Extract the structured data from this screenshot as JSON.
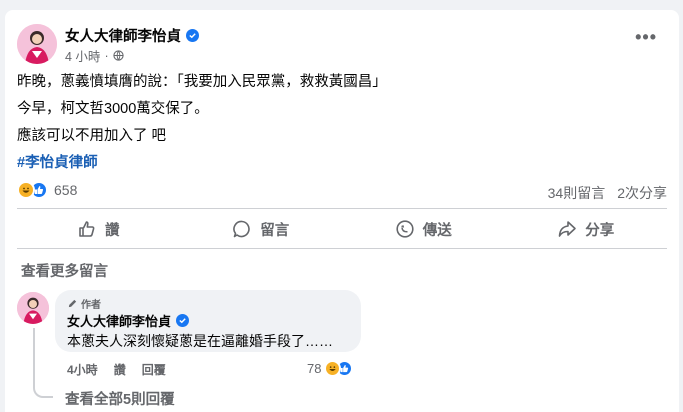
{
  "post": {
    "author": "女人大律師李怡貞",
    "time": "4 小時",
    "more_label": "•••",
    "lines": [
      "昨晚，蔥義憤填膺的說：「我要加入民眾黨，救救黃國昌」",
      "今早，柯文哲3000萬交保了。",
      "應該可以不用加入了 吧"
    ],
    "hashtag": "#李怡貞律師",
    "reaction_count": "658",
    "comment_count": "34則留言",
    "share_count": "2次分享"
  },
  "actions": {
    "like": "讚",
    "comment": "留言",
    "send": "傳送",
    "share": "分享"
  },
  "comments": {
    "view_more": "查看更多留言",
    "author_tag": "作者",
    "author": "女人大律師李怡貞",
    "text": "本蔥夫人深刻懷疑蔥是在逼離婚手段了……",
    "time": "4小時",
    "like": "讚",
    "reply": "回覆",
    "reaction_count": "78",
    "view_replies": "查看全部5則回覆"
  },
  "colors": {
    "accent": "#1877f2",
    "hashtag": "#1a5fb4",
    "muted": "#65676b",
    "avatar": "#f7c6dc"
  },
  "icons": [
    "verified-badge-icon",
    "globe-icon",
    "more-icon",
    "haha-icon",
    "like-icon",
    "comment-icon",
    "messenger-icon",
    "share-icon",
    "pencil-icon"
  ]
}
